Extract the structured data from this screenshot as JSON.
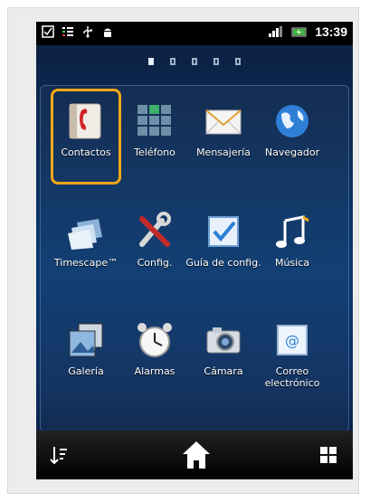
{
  "status_bar": {
    "time": "13:39",
    "left_icons": [
      "checkbox-icon",
      "notification-list-icon",
      "usb-icon",
      "android-debug-icon"
    ],
    "right_icons": [
      "signal-icon",
      "battery-icon"
    ]
  },
  "home_pages": {
    "count": 5,
    "active_index": 0
  },
  "apps": [
    {
      "label": "Contactos",
      "icon": "contacts-icon",
      "highlighted": true
    },
    {
      "label": "Teléfono",
      "icon": "phone-dialer-icon"
    },
    {
      "label": "Mensajería",
      "icon": "messaging-envelope-icon"
    },
    {
      "label": "Navegador",
      "icon": "globe-browser-icon"
    },
    {
      "label": "Timescape™",
      "icon": "timescape-icon"
    },
    {
      "label": "Config.",
      "icon": "settings-tools-icon"
    },
    {
      "label": "Guía de config.",
      "icon": "setup-guide-checkbox-icon"
    },
    {
      "label": "Música",
      "icon": "music-note-icon"
    },
    {
      "label": "Galería",
      "icon": "gallery-icon"
    },
    {
      "label": "Alarmas",
      "icon": "alarm-clock-icon"
    },
    {
      "label": "Cámara",
      "icon": "camera-icon"
    },
    {
      "label": "Correo electrónico",
      "icon": "email-icon"
    }
  ],
  "bottom_bar": {
    "sort_icon": "sort-icon",
    "home_icon": "home-icon",
    "apps_icon": "apps-grid-icon"
  },
  "colors": {
    "highlight": "#f2a817"
  }
}
